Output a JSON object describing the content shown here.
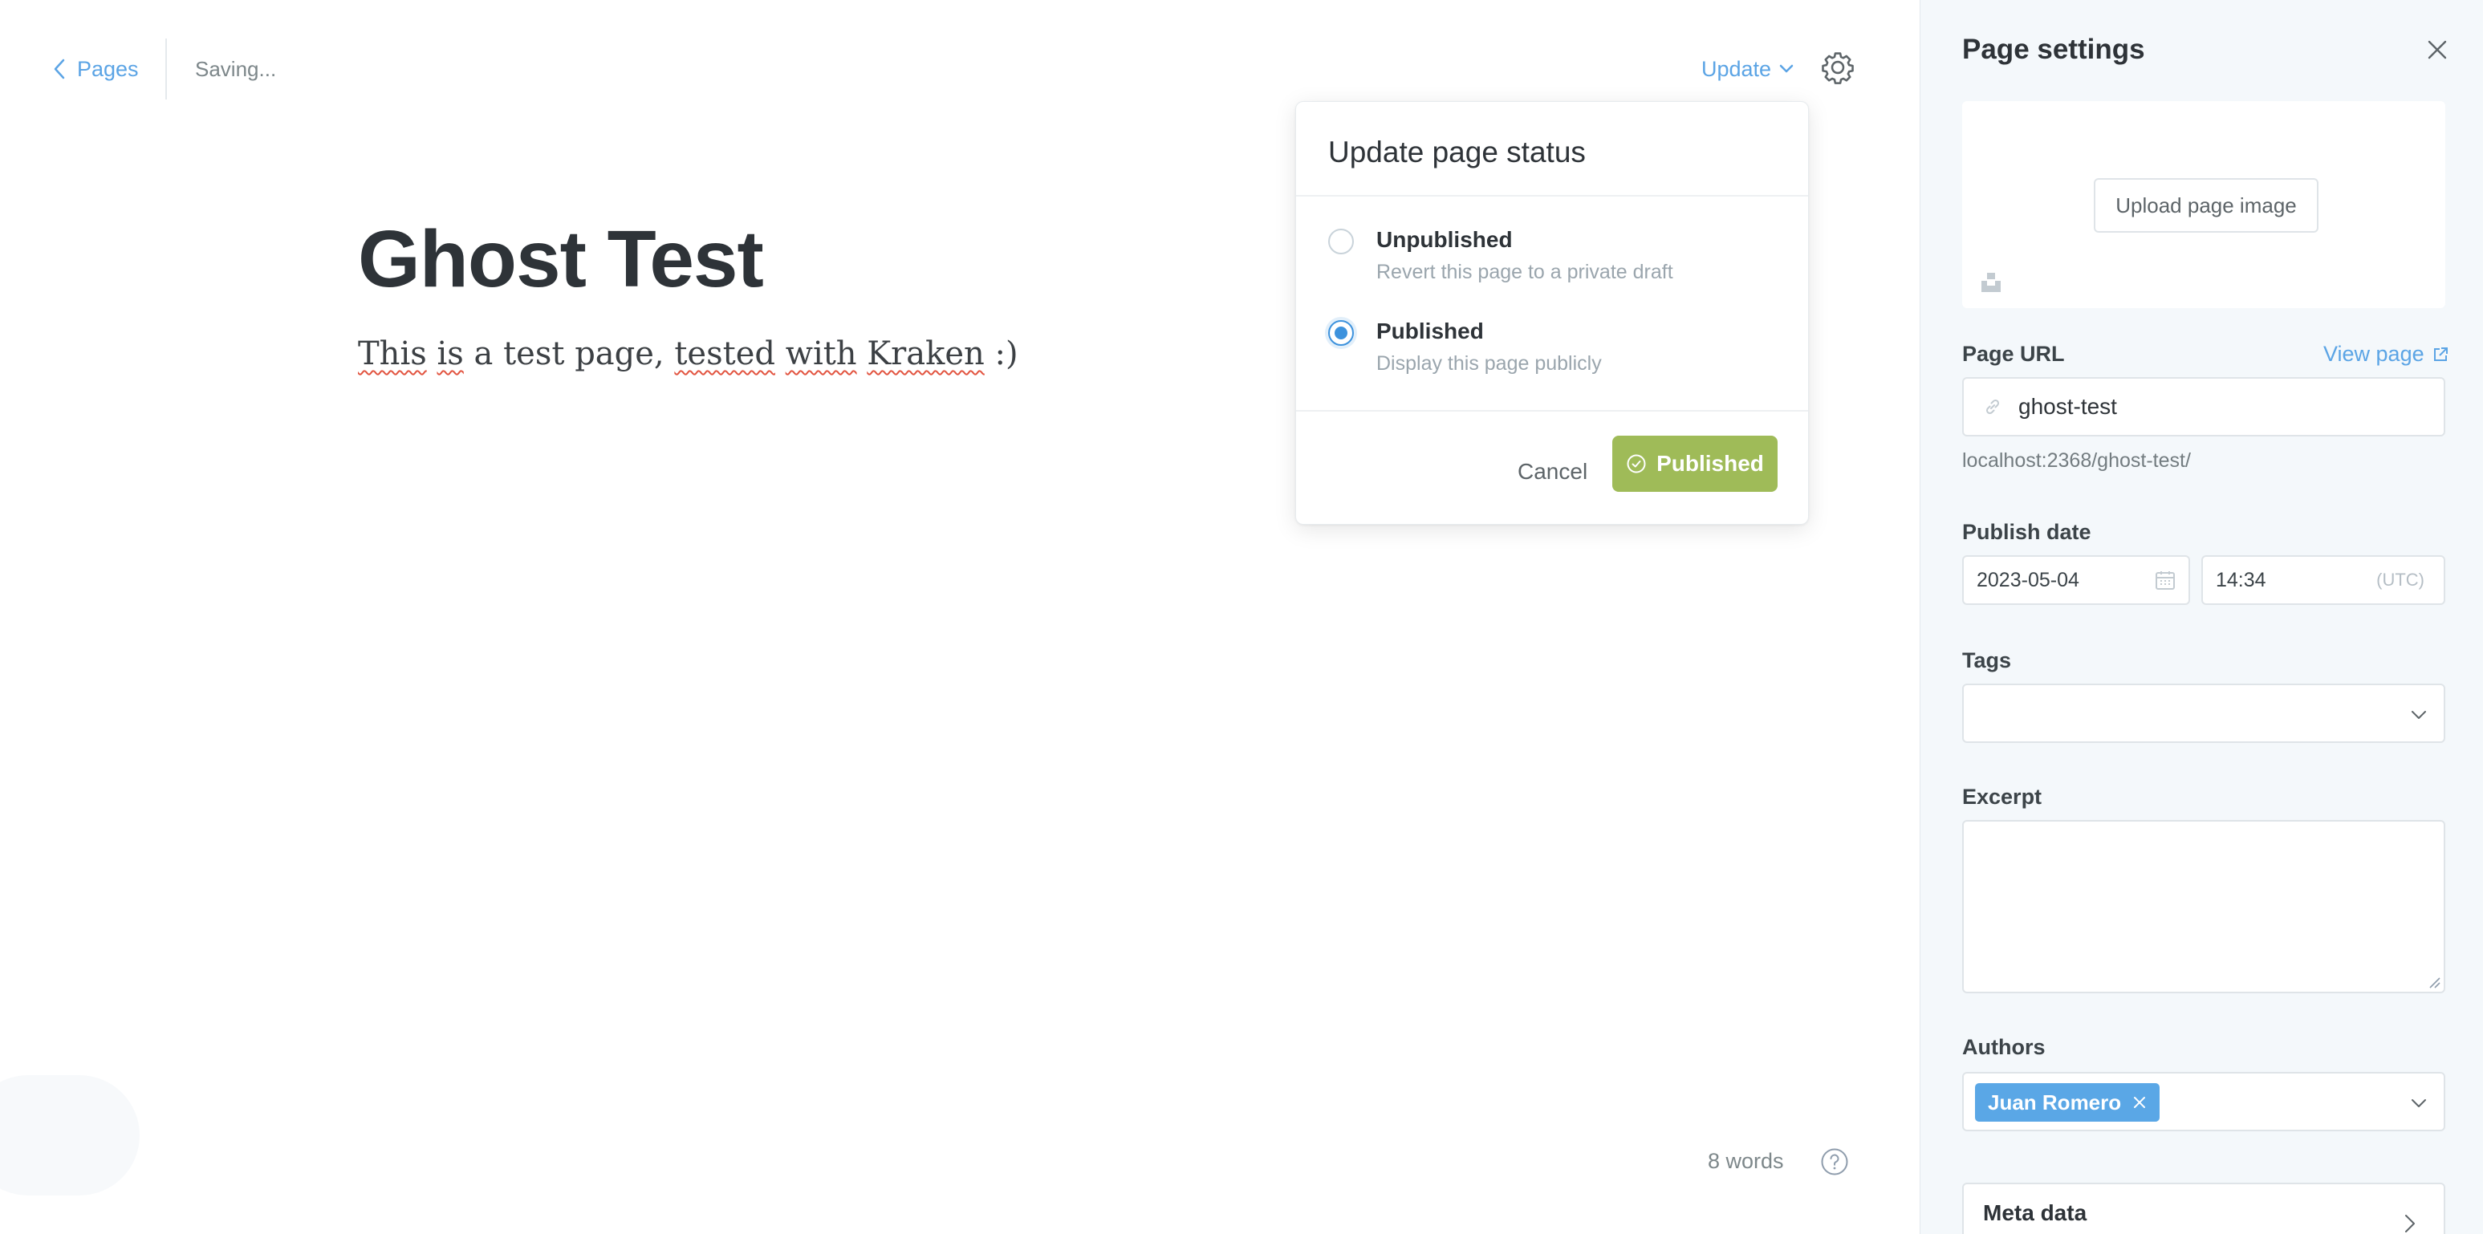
{
  "header": {
    "back_label": "Pages",
    "status_text": "Saving...",
    "update_label": "Update"
  },
  "editor": {
    "title": "Ghost Test",
    "body_words": [
      "This",
      "is",
      "a",
      "test",
      "page,",
      "tested",
      "with",
      "Kraken",
      ":)"
    ],
    "word_count": "8 words"
  },
  "status_popover": {
    "title": "Update page status",
    "options": [
      {
        "label": "Unpublished",
        "description": "Revert this page to a private draft",
        "selected": false
      },
      {
        "label": "Published",
        "description": "Display this page publicly",
        "selected": true
      }
    ],
    "cancel_label": "Cancel",
    "confirm_label": "Published"
  },
  "settings": {
    "title": "Page settings",
    "upload_image_label": "Upload page image",
    "page_url_label": "Page URL",
    "view_page_label": "View page",
    "slug": "ghost-test",
    "url_preview": "localhost:2368/ghost-test/",
    "publish_date_label": "Publish date",
    "date": "2023-05-04",
    "time": "14:34",
    "timezone": "(UTC)",
    "tags_label": "Tags",
    "tags_value": "",
    "excerpt_label": "Excerpt",
    "excerpt_value": "",
    "authors_label": "Authors",
    "authors": [
      "Juan Romero"
    ],
    "meta_data_label": "Meta data"
  },
  "colors": {
    "link_blue": "#5ba4e5",
    "published_green": "#9fbb58",
    "radio_blue": "#3d92dd",
    "panel_bg": "#f4f8fb"
  },
  "icons": [
    "chevron-left-icon",
    "chevron-down-icon",
    "gear-icon",
    "check-circle-icon",
    "help-icon",
    "close-icon",
    "link-icon",
    "external-link-icon",
    "calendar-icon",
    "unsplash-icon",
    "chevron-right-icon"
  ]
}
